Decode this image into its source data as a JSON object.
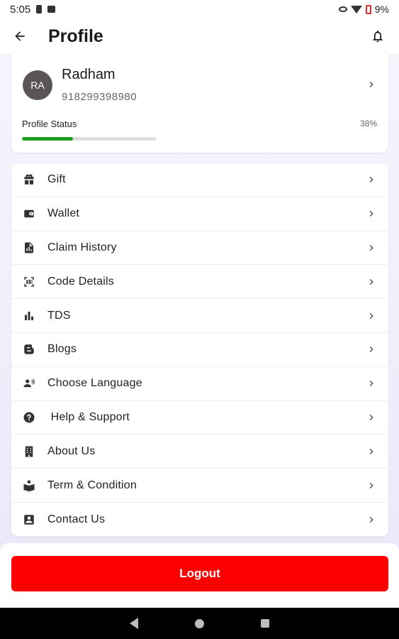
{
  "status_bar": {
    "time": "5:05",
    "battery": "9%"
  },
  "app_bar": {
    "title": "Profile"
  },
  "profile": {
    "initials": "RA",
    "name": "Radham",
    "phone": "918299398980",
    "status_label": "Profile Status",
    "status_percent": "38%",
    "status_value": 0.38,
    "progress_color": "#1e9e22"
  },
  "menu": {
    "items": [
      {
        "label": "Gift",
        "icon": "gift-icon"
      },
      {
        "label": "Wallet",
        "icon": "wallet-icon"
      },
      {
        "label": "Claim History",
        "icon": "claim-history-icon"
      },
      {
        "label": "Code Details",
        "icon": "qr-scan-icon"
      },
      {
        "label": "TDS",
        "icon": "bar-chart-icon"
      },
      {
        "label": "Blogs",
        "icon": "blog-icon"
      },
      {
        "label": "Choose Language",
        "icon": "voice-person-icon"
      },
      {
        "label": " Help & Support",
        "icon": "help-icon"
      },
      {
        "label": "About Us",
        "icon": "building-icon"
      },
      {
        "label": "Term & Condition",
        "icon": "reading-icon"
      },
      {
        "label": "Contact Us",
        "icon": "contact-icon"
      }
    ]
  },
  "logout": {
    "label": "Logout",
    "color": "#ff0000"
  }
}
